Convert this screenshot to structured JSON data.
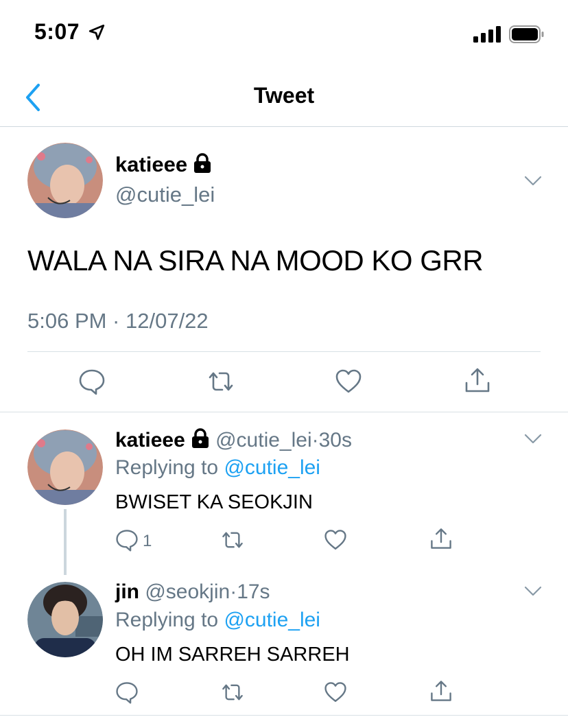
{
  "status_bar": {
    "time": "5:07"
  },
  "nav": {
    "title": "Tweet"
  },
  "main_tweet": {
    "name": "katieee",
    "handle": "@cutie_lei",
    "text": "WALA NA SIRA NA MOOD KO GRR",
    "timestamp": "5:06 PM · 12/07/22"
  },
  "replies": [
    {
      "name": "katieee",
      "handle": "@cutie_lei",
      "time": "30s",
      "replying_prefix": "Replying to",
      "replying_to": "@cutie_lei",
      "text": "BWISET KA SEOKJIN",
      "reply_count": "1"
    },
    {
      "name": "jin",
      "handle": "@seokjin",
      "time": "17s",
      "replying_prefix": "Replying to",
      "replying_to": "@cutie_lei",
      "text": "OH IM SARREH SARREH"
    }
  ],
  "colors": {
    "accent": "#1da1f2",
    "secondary_text": "#657786",
    "divider": "#d8e0e5"
  },
  "icons": {
    "reply": "speech-bubble-icon",
    "retweet": "retweet-icon",
    "like": "heart-icon",
    "share": "share-icon",
    "locked": "lock-icon"
  }
}
